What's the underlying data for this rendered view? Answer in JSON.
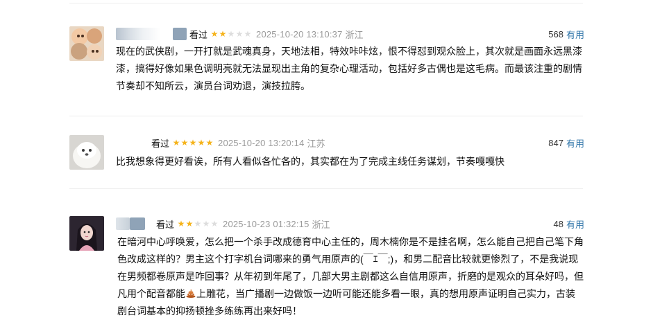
{
  "comments": [
    {
      "watched": "看过",
      "rating": 2,
      "time": "2025-10-20 13:10:37",
      "location": "浙江",
      "votes": "568",
      "useful_label": "有用",
      "text": "现在的武侠剧，一开打就是武魂真身，天地法相，特效咔咔炫，恨不得怼到观众脸上，其次就是画面永远黑漆漆，搞得好像如果色调明亮就无法显现出主角的复杂心理活动，包括好多古偶也是这毛病。而最该注重的剧情节奏却不知所云，演员台词劝退，演技拉胯。"
    },
    {
      "watched": "看过",
      "rating": 5,
      "time": "2025-10-20 13:20:14",
      "location": "江苏",
      "votes": "847",
      "useful_label": "有用",
      "text": "比我想象得更好看诶，所有人看似各忙各的，其实都在为了完成主线任务谋划，节奏嘎嘎快"
    },
    {
      "watched": "看过",
      "rating": 2,
      "time": "2025-10-23 01:32:15",
      "location": "浙江",
      "votes": "48",
      "useful_label": "有用",
      "text_part1": "在暗河中心呼唤爱，怎么把一个杀手改成德育中心主任的，周木楠你是不是挂名啊，怎么能自己把自己笔下角色改成这样的？男主这个打字机台词哪来的勇气用原声的(￣ｴ￣;)，和男二配音比较就更惨烈了，不是我说现在男频都卷原声是咋回事？从年初到年尾了，几部大男主剧都这么自信用原声，折磨的是观众的耳朵好吗，但凡用个配音都能",
      "poop_icon": "poop-emoji-icon",
      "text_part2": "上雕花，当广播剧一边做饭一边听可能还能多看一眼，真的想用原声证明自己实力，古装剧台词基本的抑扬顿挫多练练再出来好吗！"
    }
  ],
  "colors": {
    "star_on": "#f5b31b",
    "star_off": "#dddddd",
    "meta_gray": "#9a9a9a",
    "link_blue": "#3377aa"
  }
}
